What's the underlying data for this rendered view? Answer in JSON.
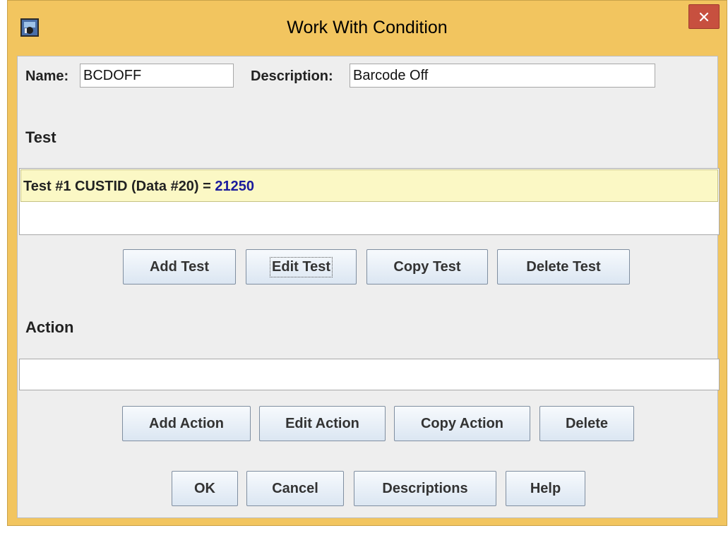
{
  "window": {
    "title": "Work With Condition",
    "colors": {
      "frame": "#f2c55f",
      "close": "#c7503f",
      "selected_row": "#fbf8c5",
      "value_text": "#1a1a9c"
    }
  },
  "form": {
    "name_label": "Name:",
    "name_value": "BCDOFF",
    "description_label": "Description:",
    "description_value": "Barcode Off"
  },
  "test": {
    "heading": "Test",
    "rows": [
      {
        "label": "Test #1  CUSTID (Data #20) = ",
        "value": "21250"
      }
    ],
    "buttons": {
      "add": "Add Test",
      "edit": "Edit Test",
      "copy": "Copy Test",
      "delete": "Delete Test"
    }
  },
  "action": {
    "heading": "Action",
    "buttons": {
      "add": "Add Action",
      "edit": "Edit Action",
      "copy": "Copy Action",
      "delete": "Delete"
    }
  },
  "dialog_buttons": {
    "ok": "OK",
    "cancel": "Cancel",
    "descriptions": "Descriptions",
    "help": "Help"
  },
  "icons": {
    "app": "app-icon",
    "close": "close-icon"
  }
}
